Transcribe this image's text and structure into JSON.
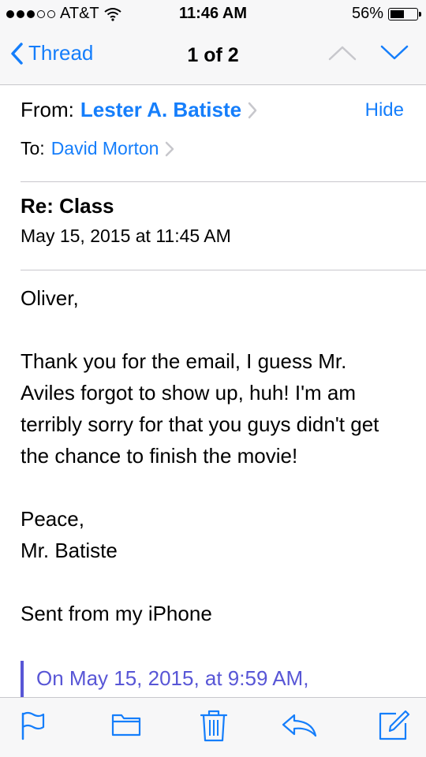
{
  "status": {
    "carrier": "AT&T",
    "time": "11:46 AM",
    "battery": "56%",
    "battery_level": 0.56
  },
  "nav": {
    "back_label": "Thread",
    "title": "1 of 2"
  },
  "header": {
    "from_label": "From:",
    "from_name": "Lester A. Batiste",
    "hide_label": "Hide",
    "to_label": "To:",
    "to_name": "David Morton"
  },
  "message": {
    "subject": "Re: Class",
    "date": "May 15, 2015 at 11:45 AM",
    "greeting": "Oliver,",
    "body": "Thank you for the email, I guess Mr. Aviles forgot to show up, huh! I'm am terribly sorry for that you guys didn't get the chance to finish the movie!",
    "signoff": "Peace,",
    "signature": "Mr. Batiste",
    "sent_from": "Sent from my iPhone",
    "quoted_header": "On May 15, 2015, at 9:59 AM,"
  },
  "colors": {
    "accent": "#157efb",
    "quote": "#5856d6",
    "divider": "#c8c7cc"
  },
  "toolbar": {
    "icons": [
      "flag-icon",
      "folder-icon",
      "trash-icon",
      "reply-icon",
      "compose-icon"
    ]
  }
}
